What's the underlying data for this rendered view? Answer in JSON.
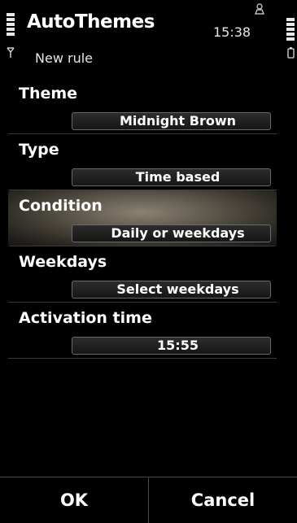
{
  "app": {
    "title": "AutoThemes",
    "subtitle": "New rule",
    "clock": "15:38"
  },
  "icons": {
    "signal": "signal-bars-icon",
    "battery": "battery-bars-icon",
    "person": "person-icon",
    "antenna": "antenna-icon",
    "battery_small": "battery-icon"
  },
  "fields": [
    {
      "label": "Theme",
      "value": "Midnight Brown"
    },
    {
      "label": "Type",
      "value": "Time based"
    },
    {
      "label": "Condition",
      "value": "Daily or weekdays"
    },
    {
      "label": "Weekdays",
      "value": "Select weekdays"
    },
    {
      "label": "Activation time",
      "value": "15:55"
    }
  ],
  "softkeys": {
    "left": "OK",
    "right": "Cancel"
  }
}
